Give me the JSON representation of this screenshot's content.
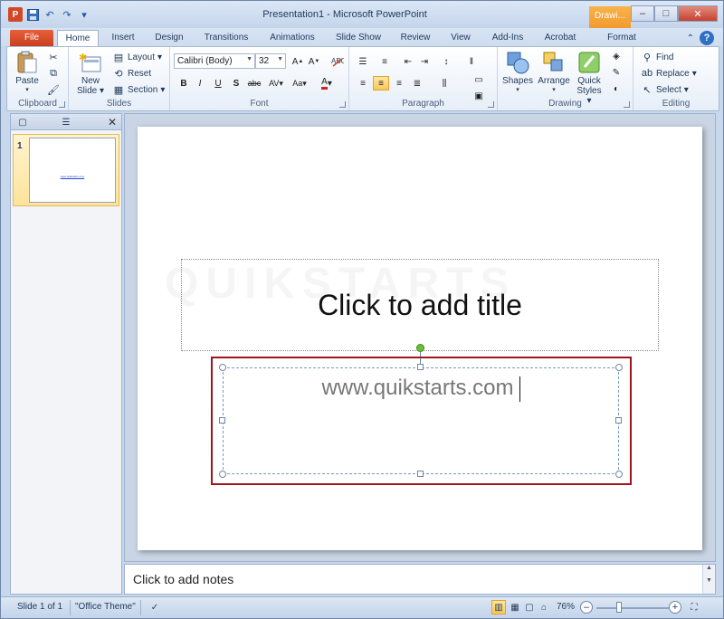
{
  "window": {
    "title": "Presentation1 - Microsoft PowerPoint",
    "context_tab": "Drawi..."
  },
  "qat": {
    "undo": "↶",
    "redo": "↷"
  },
  "tabs": [
    {
      "label": "File"
    },
    {
      "label": "Home"
    },
    {
      "label": "Insert"
    },
    {
      "label": "Design"
    },
    {
      "label": "Transitions"
    },
    {
      "label": "Animations"
    },
    {
      "label": "Slide Show"
    },
    {
      "label": "Review"
    },
    {
      "label": "View"
    },
    {
      "label": "Add-Ins"
    },
    {
      "label": "Acrobat"
    },
    {
      "label": "Format"
    }
  ],
  "ribbon": {
    "clipboard": {
      "label": "Clipboard",
      "paste": "Paste"
    },
    "slides": {
      "label": "Slides",
      "new_slide_1": "New",
      "new_slide_2": "Slide",
      "layout": "Layout",
      "reset": "Reset",
      "section": "Section"
    },
    "font": {
      "label": "Font",
      "font_name": "Calibri (Body)",
      "font_size": "32"
    },
    "paragraph": {
      "label": "Paragraph"
    },
    "drawing": {
      "label": "Drawing",
      "shapes": "Shapes",
      "arrange": "Arrange",
      "quick_1": "Quick",
      "quick_2": "Styles"
    },
    "editing": {
      "label": "Editing",
      "find": "Find",
      "replace": "Replace",
      "select": "Select"
    }
  },
  "slide_pane": {
    "thumb_number": "1",
    "thumb_text": "www.quikstarts.com"
  },
  "slide": {
    "watermark": "QUIKSTARTS",
    "title_placeholder": "Click to add title",
    "subtitle_text": "www.quikstarts.com"
  },
  "notes": {
    "placeholder": "Click to add notes"
  },
  "status": {
    "slide_info": "Slide 1 of 1",
    "theme": "\"Office Theme\"",
    "zoom": "76%"
  }
}
